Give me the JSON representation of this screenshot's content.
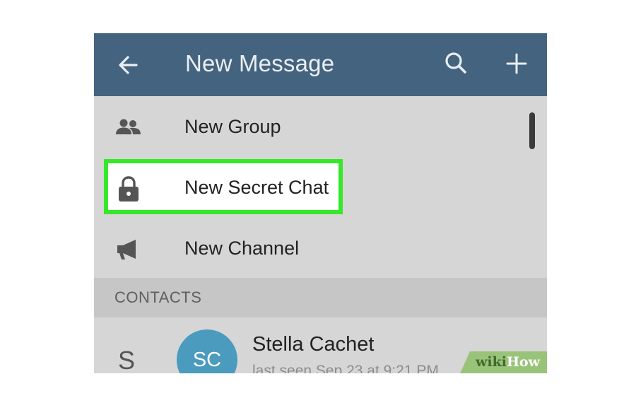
{
  "app_bar": {
    "title": "New Message",
    "back_icon": "arrow-left-icon",
    "search_icon": "search-icon",
    "add_icon": "plus-icon",
    "color": "#44637f"
  },
  "menu": {
    "items": [
      {
        "label": "New Group",
        "icon": "group-icon"
      },
      {
        "label": "New Secret Chat",
        "icon": "lock-icon",
        "highlighted": true
      },
      {
        "label": "New Channel",
        "icon": "megaphone-icon"
      }
    ]
  },
  "highlight_color": "#35e82a",
  "contacts": {
    "section_label": "CONTACTS",
    "items": [
      {
        "letter": "S",
        "initials": "SC",
        "name": "Stella Cachet",
        "status": "last seen Sep 23 at 9:21 PM",
        "avatar_color": "#4a9bbd"
      }
    ]
  },
  "watermark": {
    "wiki": "wiki",
    "how": "How"
  }
}
